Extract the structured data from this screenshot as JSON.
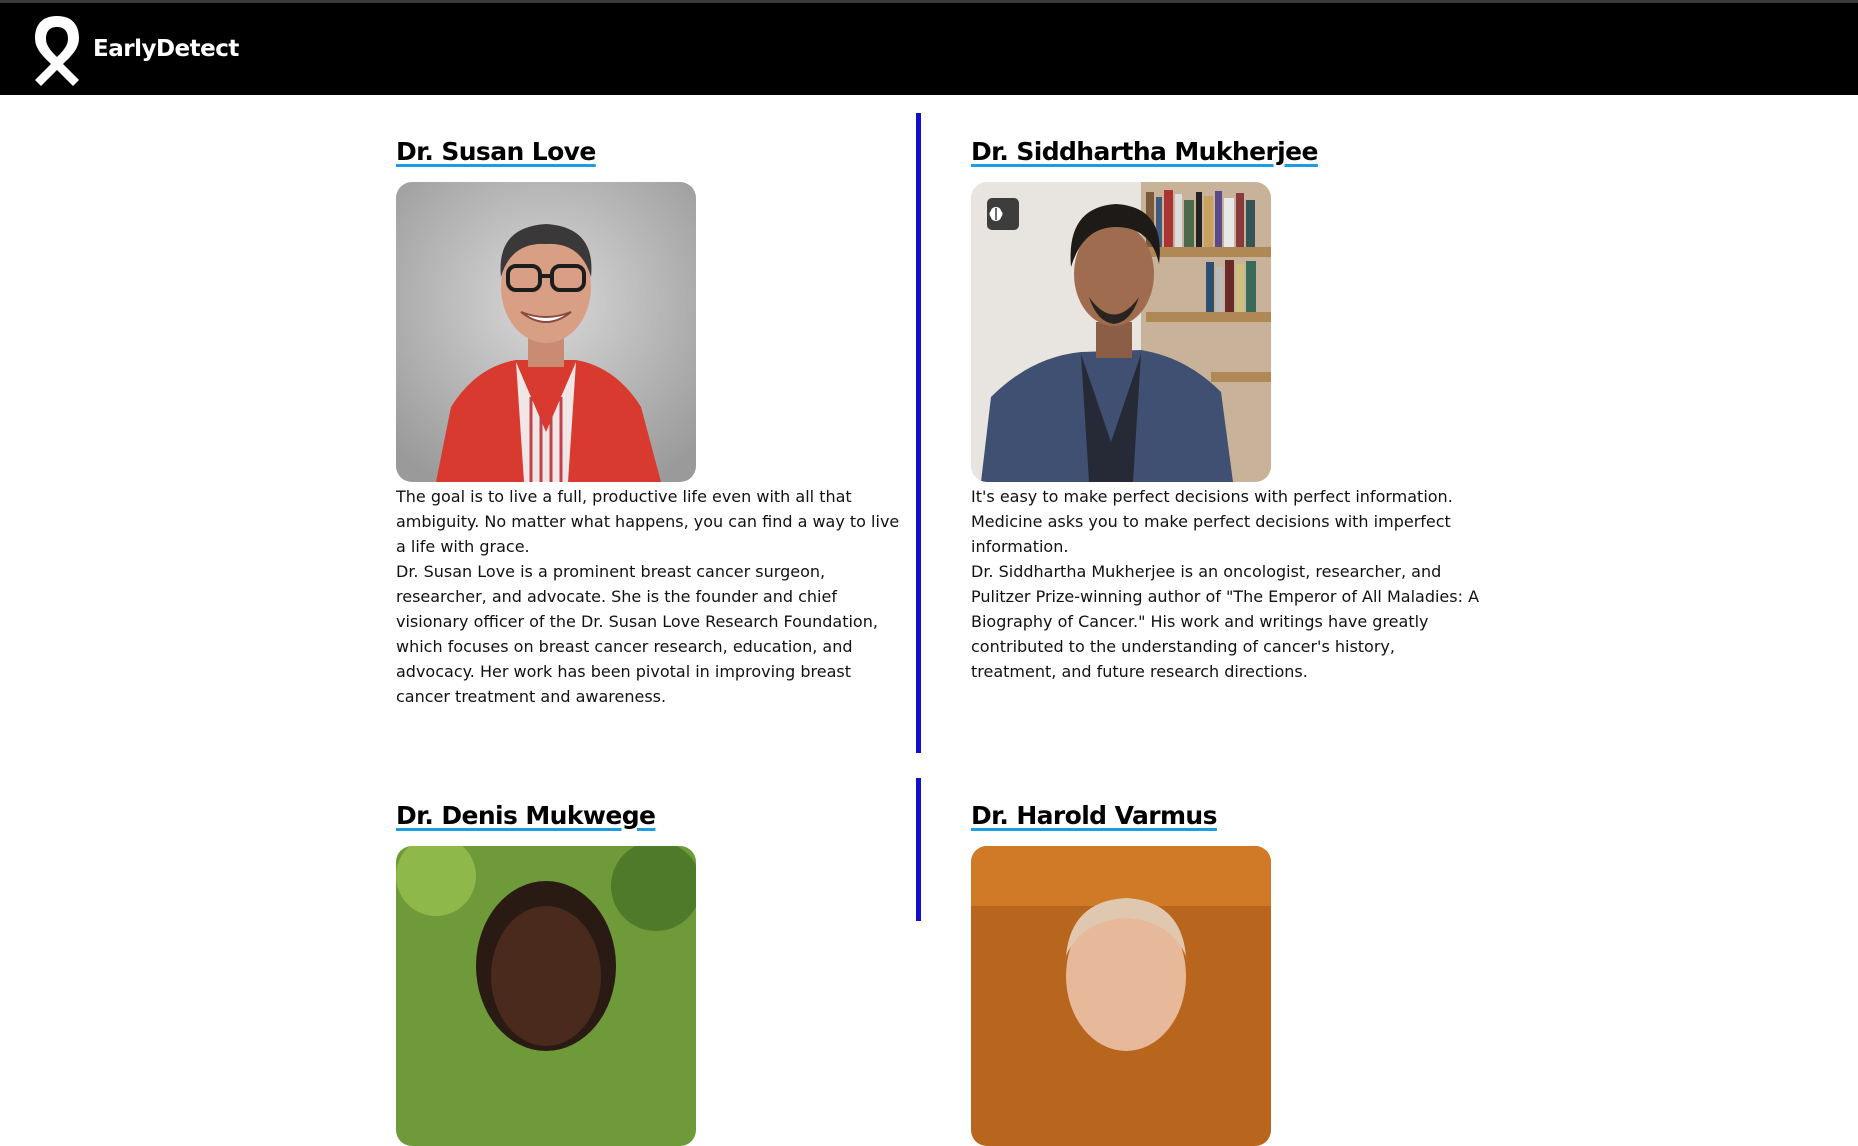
{
  "app": {
    "brand": "EarlyDetect",
    "logo_icon": "awareness-ribbon-icon"
  },
  "colors": {
    "navbar": "#000000",
    "divider": "#1010c8",
    "underline": "#1d9be3"
  },
  "doctors": [
    {
      "name": "Dr. Susan Love",
      "photo_icon": "portrait-photo",
      "quote": "The goal is to live a full, productive life even with all that ambiguity. No matter what happens, you can find a way to live a life with grace.",
      "bio": "Dr. Susan Love is a prominent breast cancer surgeon, researcher, and advocate. She is the founder and chief visionary officer of the Dr. Susan Love Research Foundation, which focuses on breast cancer research, education, and advocacy. Her work has been pivotal in improving breast cancer treatment and awareness."
    },
    {
      "name": "Dr. Siddhartha Mukherjee",
      "photo_icon": "portrait-photo",
      "badge_icon": "brain-icon",
      "quote": "It's easy to make perfect decisions with perfect information. Medicine asks you to make perfect decisions with imperfect information.",
      "bio": "Dr. Siddhartha Mukherjee is an oncologist, researcher, and Pulitzer Prize-winning author of \"The Emperor of All Maladies: A Biography of Cancer.\" His work and writings have greatly contributed to the understanding of cancer's history, treatment, and future research directions."
    },
    {
      "name": "Dr. Denis Mukwege",
      "photo_icon": "portrait-photo"
    },
    {
      "name": "Dr. Harold Varmus",
      "photo_icon": "portrait-photo"
    }
  ]
}
